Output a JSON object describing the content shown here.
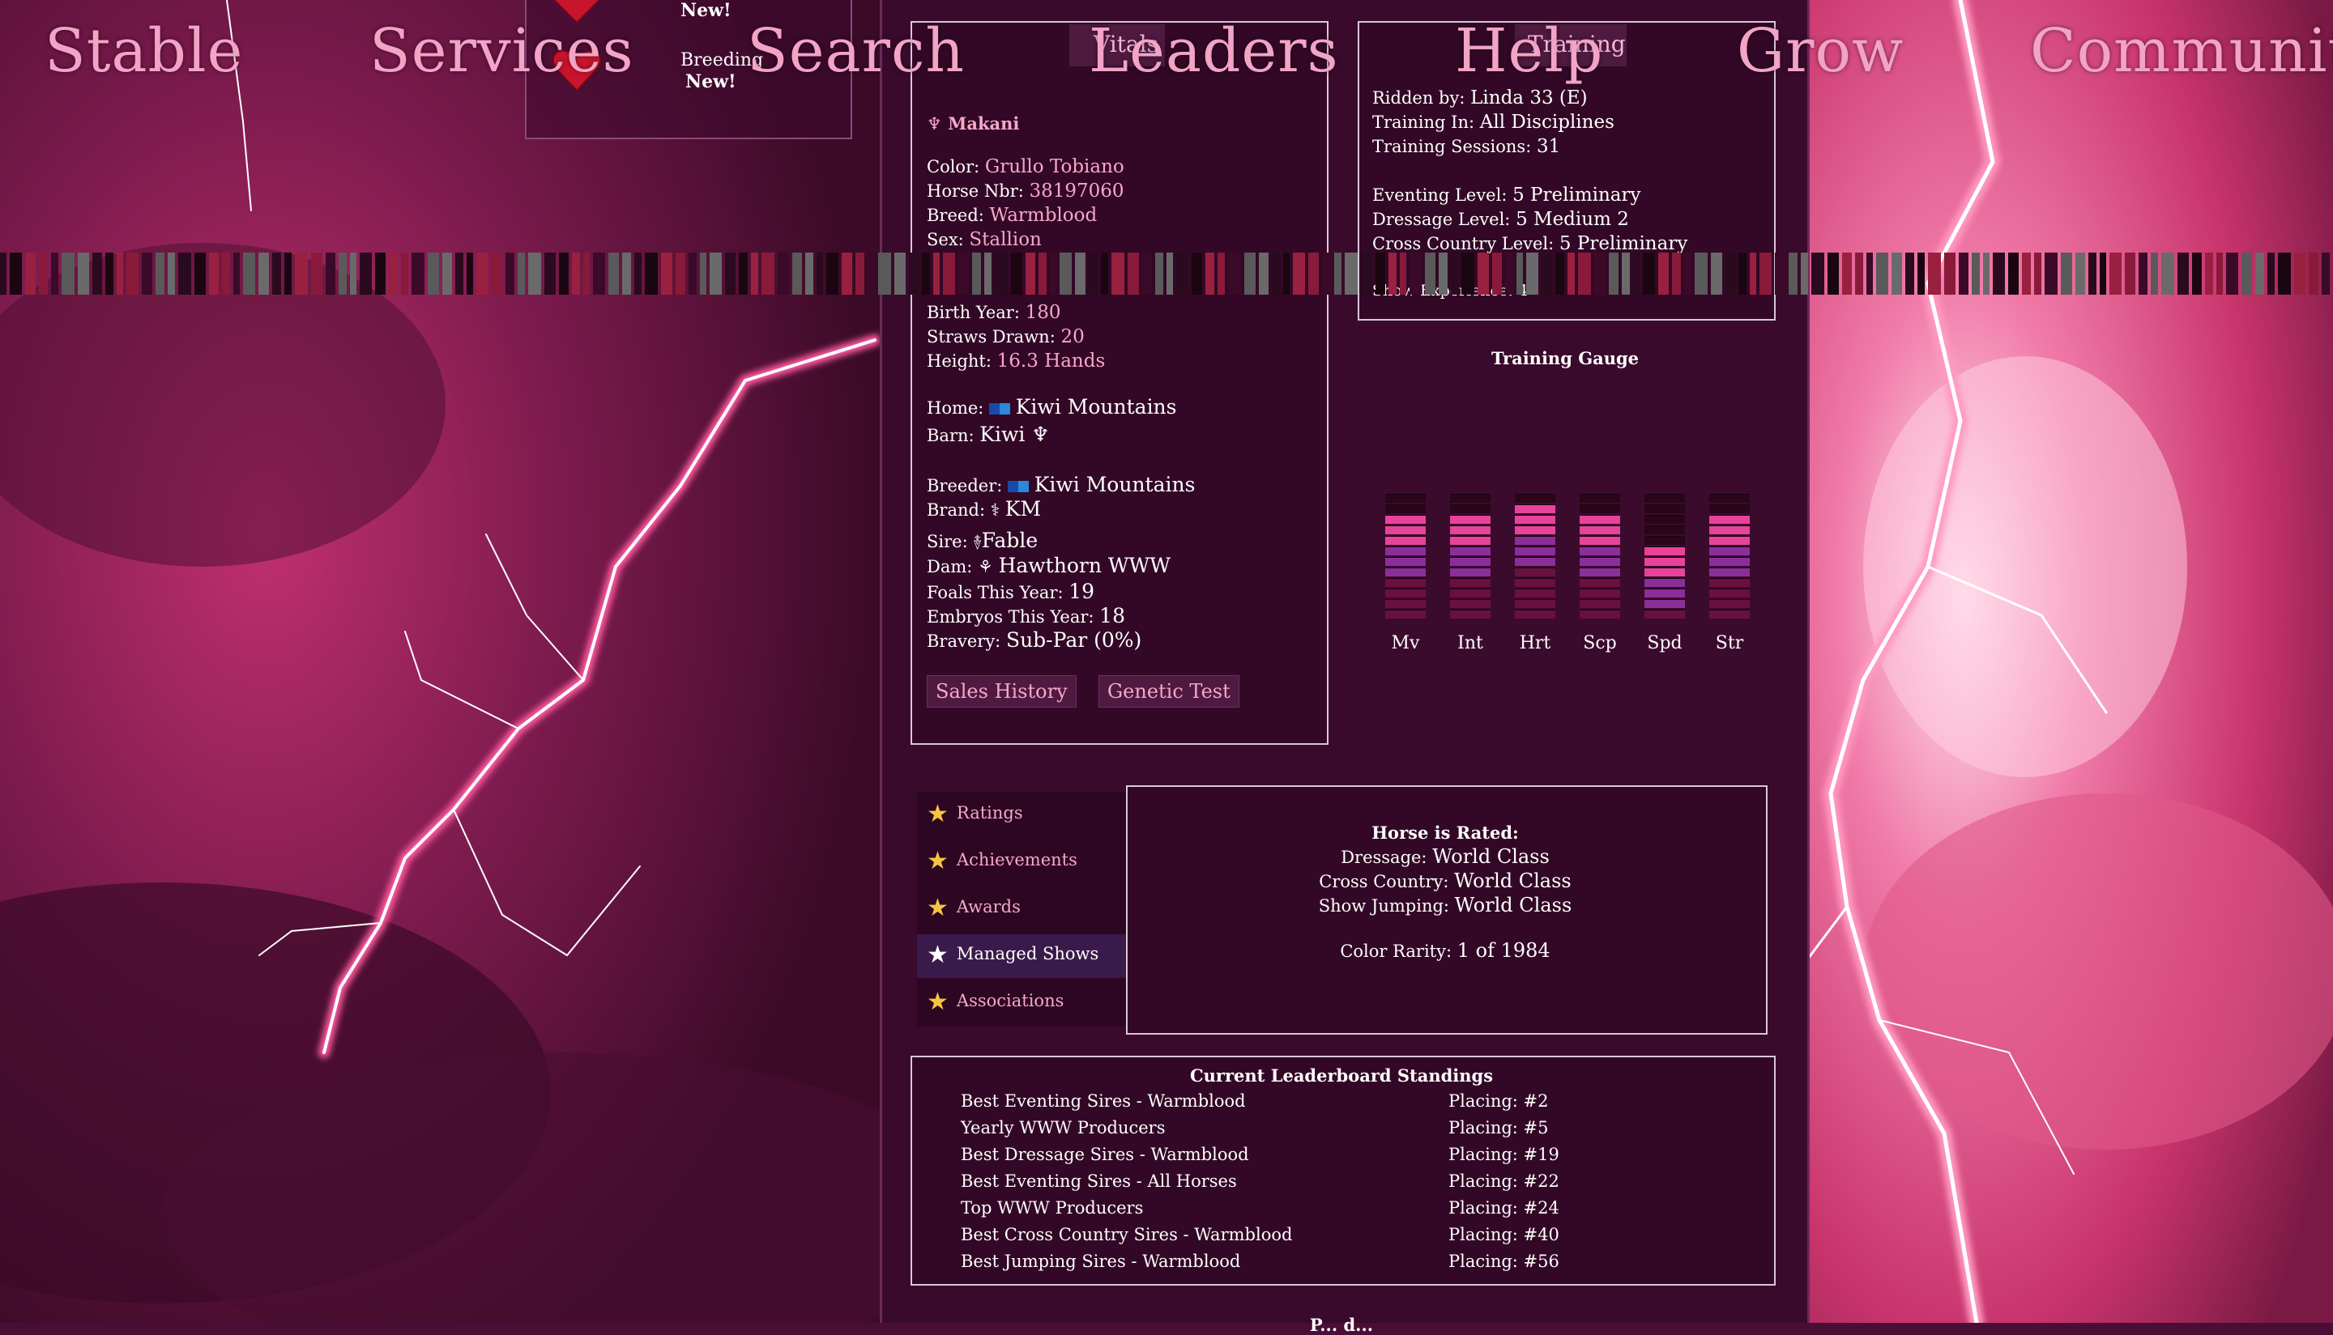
{
  "nav": {
    "stable": "Stable",
    "services": "Services",
    "search": "Search",
    "leaders": "Leaders",
    "help": "Help",
    "grow": "Grow",
    "community": "Community"
  },
  "notify": {
    "new1": "New!",
    "breeding": "Breeding",
    "new2": "New!"
  },
  "vitals": {
    "tab_label": "Vitals",
    "horse_name": "Makani",
    "rows": {
      "color_k": "Color:",
      "color_v": "Grullo Tobiano",
      "nbr_k": "Horse Nbr:",
      "nbr_v": "38197060",
      "breed_k": "Breed:",
      "breed_v": "Warmblood",
      "sex_k": "Sex:",
      "sex_v": "Stallion",
      "birth_k": "Birth Year:",
      "birth_v": "180",
      "straws_k": "Straws Drawn:",
      "straws_v": "20",
      "height_k": "Height:",
      "height_v": "16.3 Hands",
      "home_k": "Home:",
      "home_v": "Kiwi Mountains",
      "barn_k": "Barn:",
      "barn_v": "Kiwi ♆",
      "breeder_k": "Breeder:",
      "breeder_v": "Kiwi Mountains",
      "brand_k": "Brand:",
      "brand_v": "KM",
      "sire_k": "Sire:",
      "sire_v": "Fable",
      "dam_k": "Dam:",
      "dam_v": "Hawthorn WWW",
      "foals_k": "Foals This Year:",
      "foals_v": "19",
      "embryos_k": "Embryos This Year:",
      "embryos_v": "18",
      "bravery_k": "Bravery:",
      "bravery_v": "Sub-Par (0%)"
    },
    "sales_history": "Sales History",
    "genetic_test": "Genetic Test"
  },
  "training": {
    "tab_label": "Training",
    "ridden_k": "Ridden by:",
    "ridden_v": "Linda 33 (E)",
    "training_in_k": "Training In:",
    "training_in_v": "All Disciplines",
    "sessions_k": "Training Sessions:",
    "sessions_v": "31",
    "eventing_k": "Eventing Level:",
    "eventing_v": "5 Preliminary",
    "dressage_k": "Dressage Level:",
    "dressage_v": "5 Medium 2",
    "xc_k": "Cross Country Level:",
    "xc_v": "5 Preliminary",
    "show_k": "Show Experience:",
    "show_v": "4"
  },
  "gauge": {
    "title": "Training Gauge",
    "bars": [
      {
        "label": "Mv",
        "level": 0.85
      },
      {
        "label": "Int",
        "level": 0.85
      },
      {
        "label": "Hrt",
        "level": 0.95
      },
      {
        "label": "Scp",
        "level": 0.85
      },
      {
        "label": "Spd",
        "level": 0.6
      },
      {
        "label": "Str",
        "level": 0.85
      }
    ],
    "colors": {
      "high": "#e8439a",
      "mid": "#8a2f9a",
      "low": "#6a1040",
      "empty": "#2a0618"
    }
  },
  "menu": {
    "items": [
      "Ratings",
      "Achievements",
      "Awards",
      "Managed Shows",
      "Associations"
    ],
    "active_index": 3
  },
  "ratings": {
    "title": "Horse is Rated:",
    "dressage_k": "Dressage:",
    "dressage_v": "World Class",
    "xc_k": "Cross Country:",
    "xc_v": "World Class",
    "sj_k": "Show Jumping:",
    "sj_v": "World Class",
    "rarity_k": "Color Rarity:",
    "rarity_v": "1 of 1984"
  },
  "leaderboard": {
    "title": "Current Leaderboard Standings",
    "rows": [
      {
        "name": "Best Eventing Sires - Warmblood",
        "placing": "Placing: #2"
      },
      {
        "name": "Yearly WWW Producers",
        "placing": "Placing: #5"
      },
      {
        "name": "Best Dressage Sires - Warmblood",
        "placing": "Placing: #19"
      },
      {
        "name": "Best Eventing Sires - All Horses",
        "placing": "Placing: #22"
      },
      {
        "name": "Top WWW Producers",
        "placing": "Placing: #24"
      },
      {
        "name": "Best Cross Country Sires - Warmblood",
        "placing": "Placing: #40"
      },
      {
        "name": "Best Jumping Sires - Warmblood",
        "placing": "Placing: #56"
      }
    ]
  },
  "footer_partial": "P... d...",
  "theme": {
    "accent": "#f7a7c8",
    "border": "#d8c8d6",
    "bg": "#3a0a2c"
  }
}
